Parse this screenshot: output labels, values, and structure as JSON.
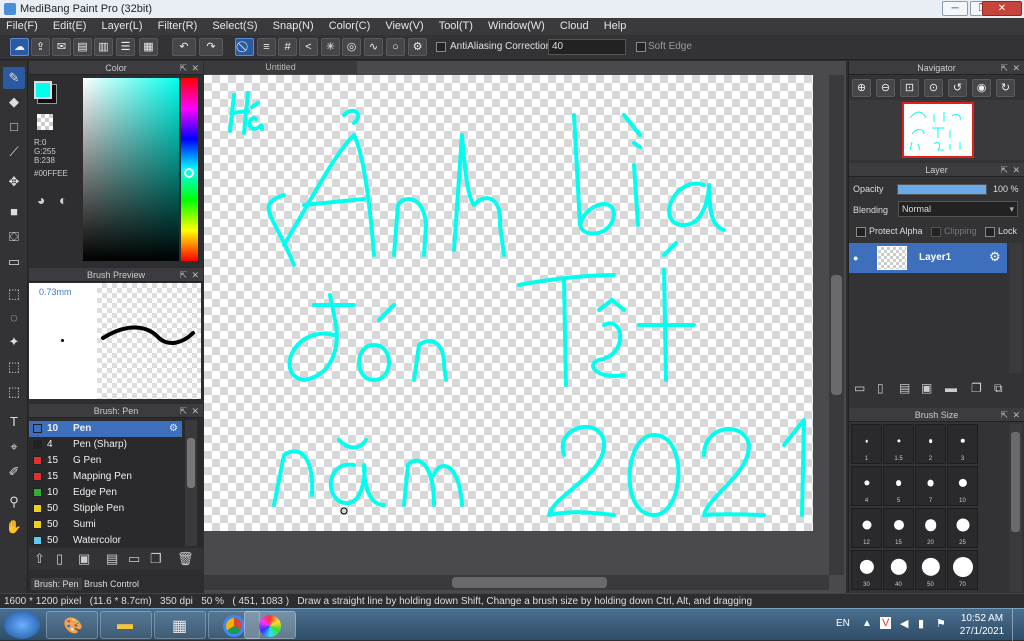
{
  "window": {
    "title": "MediBang Paint Pro (32bit)",
    "controls": {
      "minimize": "─",
      "maximize": "❐",
      "close": "✕"
    }
  },
  "menu": [
    "File(F)",
    "Edit(E)",
    "Layer(L)",
    "Filter(R)",
    "Select(S)",
    "Snap(N)",
    "Color(C)",
    "View(V)",
    "Tool(T)",
    "Window(W)",
    "Cloud",
    "Help"
  ],
  "toolbar": {
    "antialiasing_label": "AntiAliasing",
    "correction_label": "Correction",
    "correction_value": "40",
    "soft_edge_label": "Soft Edge"
  },
  "color_panel": {
    "title": "Color",
    "r": "R:0",
    "g": "G:255",
    "b": "B:238",
    "hex": "#00FFEE",
    "fg_color": "#00FFEE"
  },
  "brush_preview": {
    "title": "Brush Preview",
    "size": "0.73mm"
  },
  "brush_panel": {
    "title": "Brush: Pen",
    "items": [
      {
        "size": "10",
        "name": "Pen",
        "color": "#3d6fbd"
      },
      {
        "size": "4",
        "name": "Pen (Sharp)",
        "color": "#222222"
      },
      {
        "size": "15",
        "name": "G Pen",
        "color": "#e23030"
      },
      {
        "size": "15",
        "name": "Mapping Pen",
        "color": "#e23030"
      },
      {
        "size": "10",
        "name": "Edge Pen",
        "color": "#2fb02f"
      },
      {
        "size": "50",
        "name": "Stipple Pen",
        "color": "#e8d21c"
      },
      {
        "size": "50",
        "name": "Sumi",
        "color": "#e8d21c"
      },
      {
        "size": "50",
        "name": "Watercolor",
        "color": "#5ec8f0"
      }
    ],
    "tabs": [
      "Brush: Pen",
      "Brush Control"
    ]
  },
  "document": {
    "tab": "Untitled"
  },
  "navigator": {
    "title": "Navigator"
  },
  "layer_panel": {
    "title": "Layer",
    "opacity_label": "Opacity",
    "opacity_value": "100 %",
    "opacity": 1.0,
    "blending_label": "Blending",
    "blending_value": "Normal",
    "protect_alpha": "Protect Alpha",
    "clipping": "Clipping",
    "lock": "Lock",
    "layer_name": "Layer1"
  },
  "brush_size_panel": {
    "title": "Brush Size",
    "sizes": [
      "1",
      "1.5",
      "2",
      "3",
      "4",
      "5",
      "7",
      "10",
      "12",
      "15",
      "20",
      "25",
      "30",
      "40",
      "50",
      "70"
    ]
  },
  "status": {
    "dimensions": "1600 * 1200 pixel",
    "physical": "(11.6 * 8.7cm)",
    "dpi": "350 dpi",
    "zoom": "50 %",
    "cursor": "( 451, 1083 )",
    "hint": "Draw a straight line by holding down Shift, Change a brush size by holding down Ctrl, Alt, and dragging"
  },
  "taskbar": {
    "lang": "EN",
    "time": "10:52 AM",
    "date": "27/1/2021"
  },
  "colors": {
    "accent": "#00FFEE",
    "selection": "#3d6fbd"
  }
}
